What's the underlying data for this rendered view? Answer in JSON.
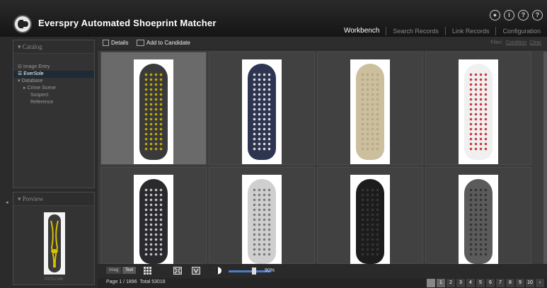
{
  "app": {
    "title": "Everspry Automated Shoeprint Matcher",
    "top_icons": [
      "user-icon",
      "info-icon",
      "help-icon",
      "question-icon"
    ],
    "nav": [
      "Workbench",
      "Search Records",
      "Link Records",
      "Configuration"
    ]
  },
  "catalog": {
    "header": "Catalog",
    "items": [
      {
        "label": "Image Entry",
        "selected": false
      },
      {
        "label": "EverSole",
        "selected": true
      },
      {
        "label": "Database",
        "selected": false
      },
      {
        "label": "Crime Scene",
        "selected": false
      },
      {
        "label": "Suspect",
        "selected": false
      },
      {
        "label": "Reference",
        "selected": false
      }
    ]
  },
  "preview": {
    "header": "Preview",
    "caption": "00052348"
  },
  "toolbar": {
    "details": "Details",
    "add_candidate": "Add to Candidate",
    "filter_label": "Filter:",
    "condition": "Condition",
    "clear": "Clear"
  },
  "grid": {
    "items": [
      {
        "id": 1,
        "selected": true,
        "sole_color": "#3a3a3a",
        "accent": "#d8c000"
      },
      {
        "id": 2,
        "selected": false,
        "sole_color": "#2d3550",
        "accent": "#ffffff"
      },
      {
        "id": 3,
        "selected": false,
        "sole_color": "#cbbf9e",
        "accent": "#b2a47f"
      },
      {
        "id": 4,
        "selected": false,
        "sole_color": "#f0f0f0",
        "accent": "#c0171f"
      },
      {
        "id": 5,
        "selected": false,
        "sole_color": "#2a2a2e",
        "accent": "#e0e0e0"
      },
      {
        "id": 6,
        "selected": false,
        "sole_color": "#cfcfcf",
        "accent": "#6a6a6a"
      },
      {
        "id": 7,
        "selected": false,
        "sole_color": "#1c1c1c",
        "accent": "#3a3a3a"
      },
      {
        "id": 8,
        "selected": false,
        "sole_color": "#5b5b5b",
        "accent": "#2d2d2d"
      }
    ]
  },
  "bottom": {
    "mode_image": "Imag",
    "mode_text": "Text",
    "zoom": "90%"
  },
  "status": {
    "page_info": "Page 1 / 1896",
    "total": "Total 53016",
    "pages": [
      "1",
      "2",
      "3",
      "4",
      "5",
      "6",
      "7",
      "8",
      "9",
      "10"
    ]
  },
  "colors": {
    "accent_blue": "#4a7cc8",
    "selected_row": "#1f2a38"
  }
}
